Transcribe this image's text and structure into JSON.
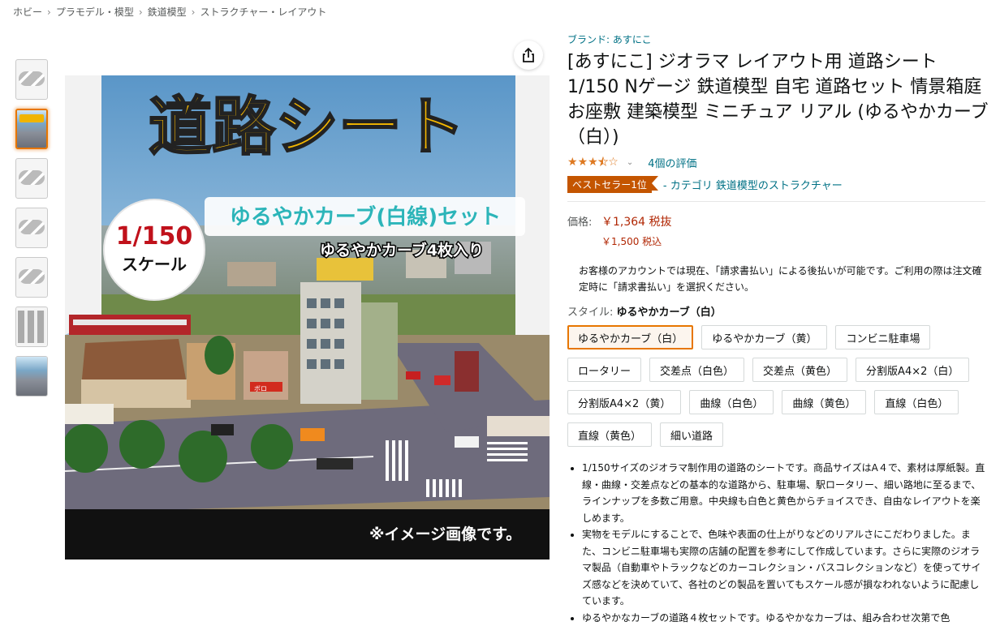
{
  "breadcrumb": [
    "ホビー",
    "プラモデル・模型",
    "鉄道模型",
    "ストラクチャー・レイアウト"
  ],
  "breadcrumb_separator": "›",
  "image": {
    "title": "道路シート",
    "subtitle": "ゆるやかカーブ(白線)セット",
    "subline": "ゆるやかカーブ4枚入り",
    "scale_top": "1/150",
    "scale_bottom": "スケール",
    "sign_text": "ボロ",
    "note": "※イメージ画像です。"
  },
  "product": {
    "brand": "ブランド: あすにこ",
    "title": "[あすにこ] ジオラマ レイアウト用 道路シート 1/150 Nゲージ 鉄道模型 自宅 道路セット 情景箱庭 お座敷 建築模型 ミニチュア リアル (ゆるやかカーブ（白）)",
    "rating": 3.5,
    "rating_count": "4個の評価",
    "bestseller_badge": "ベストセラー1位",
    "bestseller_category": "- カテゴリ 鉄道模型のストラクチャー",
    "price_label": "価格:",
    "price": "￥1,364 税抜",
    "price_tax": "￥1,500 税込",
    "notice": "お客様のアカウントでは現在、「請求書払い」による後払いが可能です。ご利用の際は注文確定時に「請求書払い」を選択ください。",
    "style_label": "スタイル:",
    "style_value": "ゆるやかカーブ（白）",
    "options": [
      "ゆるやかカーブ（白）",
      "ゆるやかカーブ（黄）",
      "コンビニ駐車場",
      "ロータリー",
      "交差点（白色）",
      "交差点（黄色）",
      "分割版A4×2（白）",
      "分割版A4×2（黄）",
      "曲線（白色）",
      "曲線（黄色）",
      "直線（白色）",
      "直線（黄色）",
      "細い道路"
    ],
    "bullets": [
      "1/150サイズのジオラマ制作用の道路のシートです。商品サイズはA４で、素材は厚紙製。直線・曲線・交差点などの基本的な道路から、駐車場、駅ロータリー、細い路地に至るまで、ラインナップを多数ご用意。中央線も白色と黄色からチョイスでき、自由なレイアウトを楽しめます。",
      "実物をモデルにすることで、色味や表面の仕上がりなどのリアルさにこだわりました。また、コンビニ駐車場も実際の店舗の配置を参考にして作成しています。さらに実際のジオラマ製品（自動車やトラックなどのカーコレクション・バスコレクションなど）を使ってサイズ感などを決めていて、各社のどの製品を置いてもスケール感が損なわれないように配慮しています。",
      "ゆるやかなカーブの道路４枚セットです。ゆるやかなカーブは、組み合わせ次第で色"
    ]
  },
  "colors": {
    "link": "#007185",
    "price": "#b12704",
    "badge": "#c45500",
    "star": "#de7921",
    "selected_border": "#e77600",
    "title_yellow": "#f6b800"
  }
}
